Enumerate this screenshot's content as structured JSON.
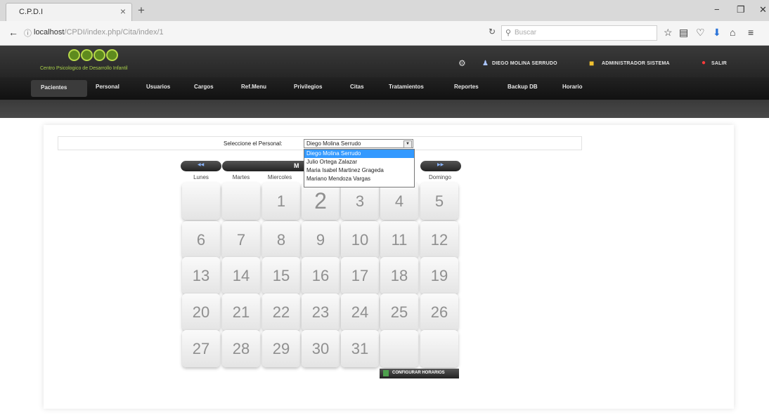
{
  "browser": {
    "tab_title": "C.P.D.I",
    "tab_close": "×",
    "new_tab": "+",
    "url_host": "localhost",
    "url_path": "/CPDI/index.php/Cita/index/1",
    "search_placeholder": "Buscar",
    "win_minimize": "−",
    "win_maximize": "❐",
    "win_close": "✕"
  },
  "app": {
    "logo_text": "Centro Psicologico de Desarrollo Infantil",
    "user_name": "DIEGO MOLINA SERRUDO",
    "role": "ADMINISTRADOR SISTEMA",
    "logout": "SALIR",
    "menu": [
      "Pacientes",
      "Personal",
      "Usuarios",
      "Cargos",
      "Ref.Menu",
      "Privilegios",
      "Citas",
      "Tratamientos",
      "Reportes",
      "Backup DB",
      "Horario"
    ]
  },
  "form": {
    "label": "Seleccione el Personal:",
    "selected": "Diego Molina Serrudo",
    "options": [
      "Diego Molina Serrudo",
      "Julio Ortega Zalazar",
      "Maria Isabel Martinez Grageda",
      "Mariano Mendoza Vargas"
    ]
  },
  "calendar": {
    "month_fragment": "M",
    "days": [
      "Lunes",
      "Martes",
      "Miercoles",
      "",
      "",
      "",
      "Domingo"
    ],
    "weeks": [
      [
        "",
        "",
        "1",
        "2",
        "3",
        "4",
        "5"
      ],
      [
        "6",
        "7",
        "8",
        "9",
        "10",
        "11",
        "12"
      ],
      [
        "13",
        "14",
        "15",
        "16",
        "17",
        "18",
        "19"
      ],
      [
        "20",
        "21",
        "22",
        "23",
        "24",
        "25",
        "26"
      ],
      [
        "27",
        "28",
        "29",
        "30",
        "31",
        "",
        ""
      ]
    ],
    "today": "2",
    "config_button": "CONFIGURAR HORARIOS"
  }
}
